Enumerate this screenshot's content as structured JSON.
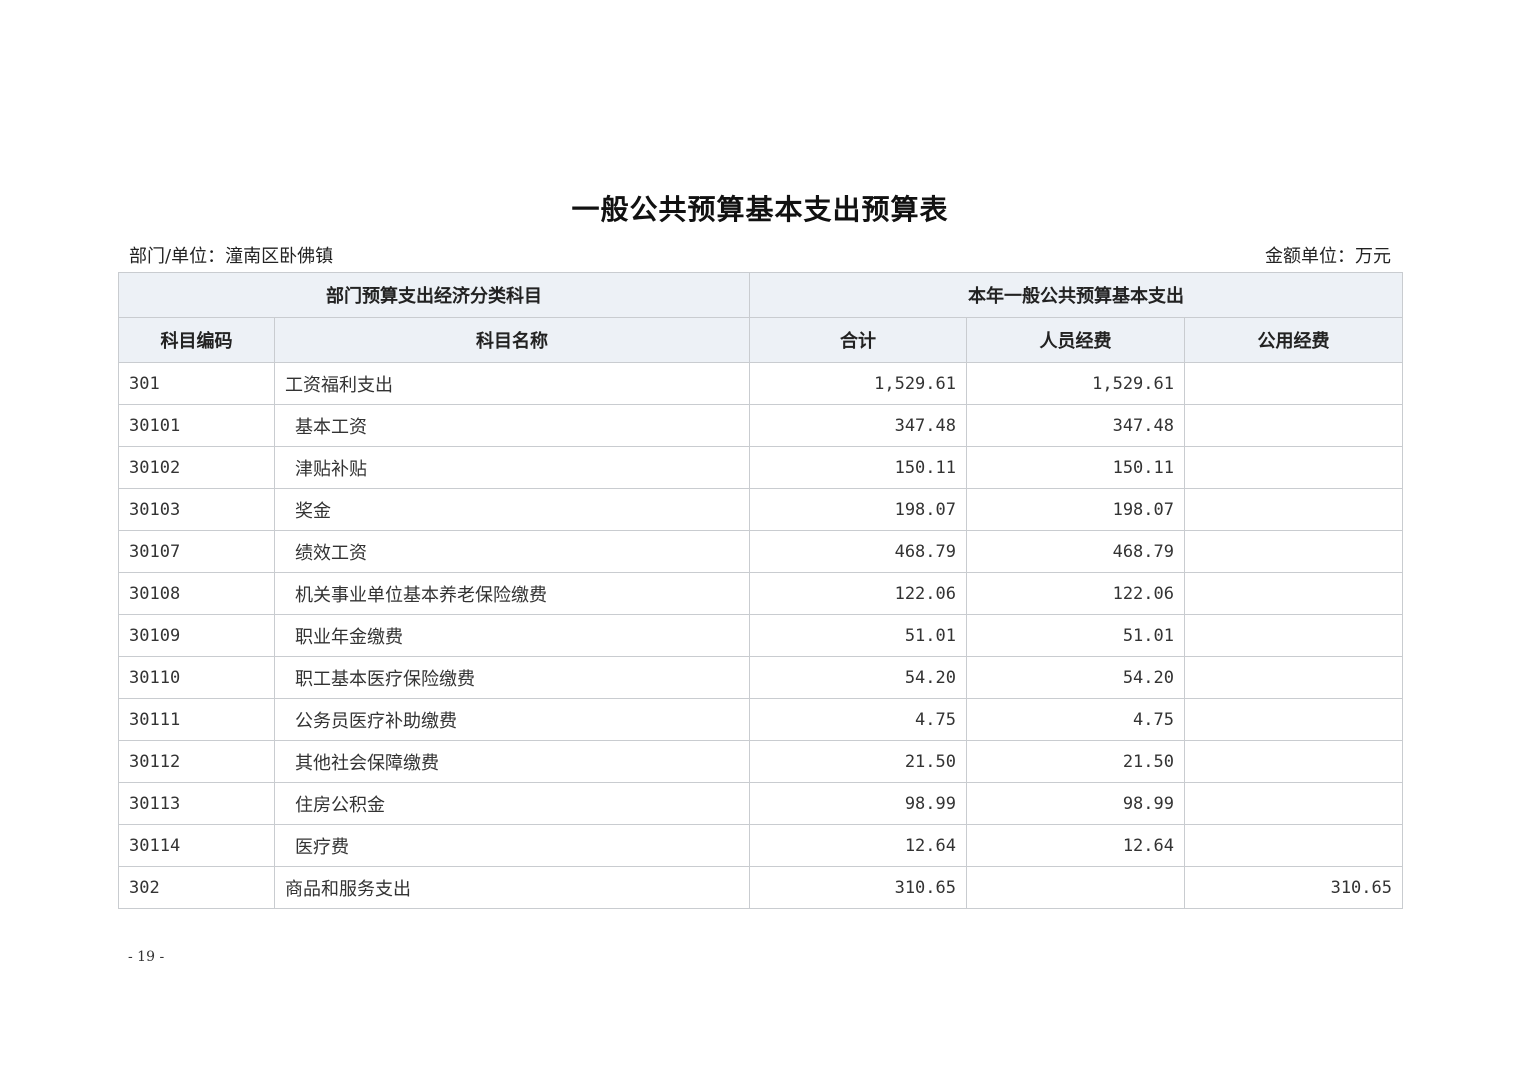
{
  "document": {
    "title": "一般公共预算基本支出预算表",
    "department": "部门/单位：潼南区卧佛镇",
    "unit": "金额单位：万元",
    "page_number": "- 19 -"
  },
  "table": {
    "group_headers": {
      "category": "部门预算支出经济分类科目",
      "current_year": "本年一般公共预算基本支出"
    },
    "columns": {
      "code": "科目编码",
      "name": "科目名称",
      "total": "合计",
      "personnel": "人员经费",
      "public": "公用经费"
    },
    "rows": [
      {
        "code": "301",
        "name": "工资福利支出",
        "total": "1,529.61",
        "personnel": "1,529.61",
        "public": "",
        "indent": false
      },
      {
        "code": "30101",
        "name": "基本工资",
        "total": "347.48",
        "personnel": "347.48",
        "public": "",
        "indent": true
      },
      {
        "code": "30102",
        "name": "津贴补贴",
        "total": "150.11",
        "personnel": "150.11",
        "public": "",
        "indent": true
      },
      {
        "code": "30103",
        "name": "奖金",
        "total": "198.07",
        "personnel": "198.07",
        "public": "",
        "indent": true
      },
      {
        "code": "30107",
        "name": "绩效工资",
        "total": "468.79",
        "personnel": "468.79",
        "public": "",
        "indent": true
      },
      {
        "code": "30108",
        "name": "机关事业单位基本养老保险缴费",
        "total": "122.06",
        "personnel": "122.06",
        "public": "",
        "indent": true
      },
      {
        "code": "30109",
        "name": "职业年金缴费",
        "total": "51.01",
        "personnel": "51.01",
        "public": "",
        "indent": true
      },
      {
        "code": "30110",
        "name": "职工基本医疗保险缴费",
        "total": "54.20",
        "personnel": "54.20",
        "public": "",
        "indent": true
      },
      {
        "code": "30111",
        "name": "公务员医疗补助缴费",
        "total": "4.75",
        "personnel": "4.75",
        "public": "",
        "indent": true
      },
      {
        "code": "30112",
        "name": "其他社会保障缴费",
        "total": "21.50",
        "personnel": "21.50",
        "public": "",
        "indent": true
      },
      {
        "code": "30113",
        "name": "住房公积金",
        "total": "98.99",
        "personnel": "98.99",
        "public": "",
        "indent": true
      },
      {
        "code": "30114",
        "name": "医疗费",
        "total": "12.64",
        "personnel": "12.64",
        "public": "",
        "indent": true
      },
      {
        "code": "302",
        "name": "商品和服务支出",
        "total": "310.65",
        "personnel": "",
        "public": "310.65",
        "indent": false
      }
    ]
  }
}
